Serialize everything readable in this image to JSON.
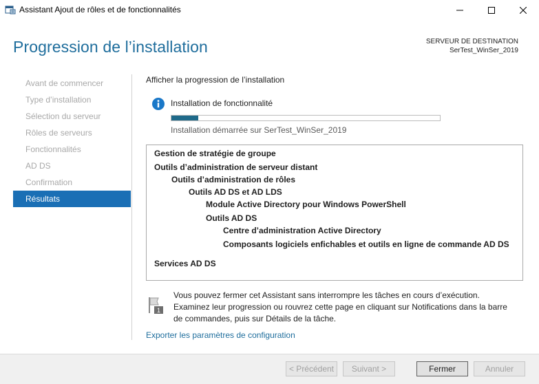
{
  "window": {
    "title": "Assistant Ajout de rôles et de fonctionnalités"
  },
  "header": {
    "page_title": "Progression de l’installation",
    "dest_label": "SERVEUR DE DESTINATION",
    "dest_server": "SerTest_WinSer_2019"
  },
  "nav": {
    "items": [
      {
        "label": "Avant de commencer",
        "active": false
      },
      {
        "label": "Type d’installation",
        "active": false
      },
      {
        "label": "Sélection du serveur",
        "active": false
      },
      {
        "label": "Rôles de serveurs",
        "active": false
      },
      {
        "label": "Fonctionnalités",
        "active": false
      },
      {
        "label": "AD DS",
        "active": false
      },
      {
        "label": "Confirmation",
        "active": false
      },
      {
        "label": "Résultats",
        "active": true
      }
    ]
  },
  "main": {
    "heading": "Afficher la progression de l’installation",
    "status_icon": "info-icon",
    "status_title": "Installation de fonctionnalité",
    "progress_fraction": 0.1,
    "status_sub": "Installation démarrée sur SerTest_WinSer_2019",
    "results": [
      {
        "text": "Gestion de stratégie de groupe",
        "level": 0
      },
      {
        "text": "Outils d’administration de serveur distant",
        "level": 0
      },
      {
        "text": "Outils d’administration de rôles",
        "level": 1
      },
      {
        "text": "Outils AD DS et AD LDS",
        "level": 2
      },
      {
        "text": "Module Active Directory pour Windows PowerShell",
        "level": 3
      },
      {
        "text": "Outils AD DS",
        "level": 3
      },
      {
        "text": "Centre d’administration Active Directory",
        "level": 4
      },
      {
        "text": "Composants logiciels enfichables et outils en ligne de commande AD DS",
        "level": 4
      },
      {
        "text": "Services AD DS",
        "level": 0
      }
    ],
    "note_icon": "notification-flag-icon",
    "note": "Vous pouvez fermer cet Assistant sans interrompre les tâches en cours d’exécution. Examinez leur progression ou rouvrez cette page en cliquant sur Notifications dans la barre de commandes, puis sur Détails de la tâche.",
    "export_link": "Exporter les paramètres de configuration"
  },
  "footer": {
    "prev_label": "< Précédent",
    "next_label": "Suivant >",
    "close_label": "Fermer",
    "cancel_label": "Annuler"
  },
  "colors": {
    "accent": "#1a6fb5",
    "title_blue": "#1e6d9c",
    "progress": "#1f6a8a"
  }
}
